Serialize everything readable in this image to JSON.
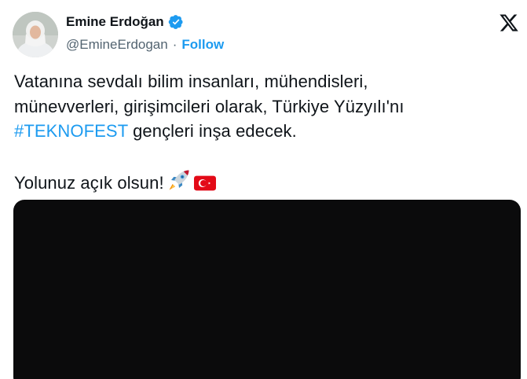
{
  "author": {
    "display_name": "Emine Erdoğan",
    "handle": "@EmineErdogan",
    "separator": "·",
    "follow_label": "Follow",
    "verified_icon": "verified-badge-icon",
    "verified_color": "#1d9bf0"
  },
  "platform": {
    "logo_icon": "x-logo-icon"
  },
  "tweet": {
    "line1": "Vatanına sevdalı bilim insanları, mühendisleri,",
    "line2": "münevverleri, girişimcileri olarak, Türkiye Yüzyılı'nı",
    "hashtag": "#TEKNOFEST",
    "line3_rest": " gençleri inşa edecek.",
    "closing": "Yolunuz açık olsun!",
    "emojis": [
      "rocket-icon",
      "turkey-flag-icon"
    ]
  },
  "colors": {
    "text": "#0f1419",
    "secondary": "#536471",
    "accent": "#1d9bf0",
    "media_bg": "#0b0b0c",
    "flag_red": "#e30a17"
  }
}
